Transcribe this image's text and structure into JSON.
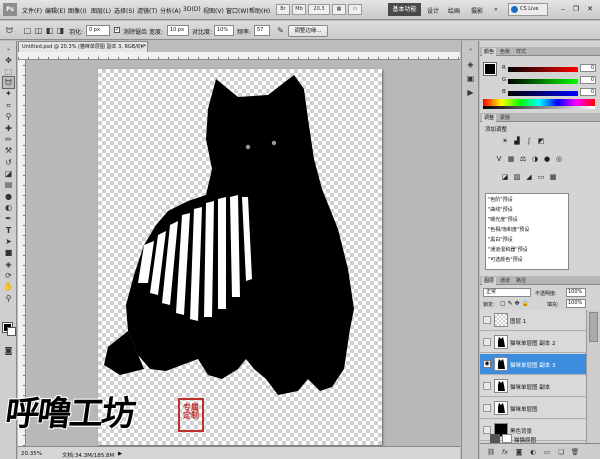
{
  "app": {
    "logo": "Ps",
    "menus": [
      "文件(F)",
      "编辑(E)",
      "图像(I)",
      "图层(L)",
      "选择(S)",
      "滤镜(T)",
      "分析(A)",
      "3D(D)",
      "视图(V)",
      "窗口(W)",
      "帮助(H)"
    ],
    "zoom_box": "20.3",
    "workspaces": {
      "active": "基本功能",
      "others": [
        "设计",
        "绘画",
        "摄影"
      ],
      "more": "»"
    },
    "cslive": "CS Live"
  },
  "options": {
    "feather_label": "羽化:",
    "feather_value": "0 px",
    "antialias_label": "消除锯齿",
    "width_label": "宽度:",
    "width_value": "10 px",
    "contrast_label": "对比度:",
    "contrast_value": "10%",
    "freq_label": "频率:",
    "freq_value": "57",
    "refine_button": "调整边缘..."
  },
  "document": {
    "tab": "Untitled.psd @ 20.3% (猫咪单层图 副本 3, RGB/8) *",
    "close": "×"
  },
  "status": {
    "zoom": "20.35%",
    "doc": "文档:34.3M/185.8M"
  },
  "watermark": {
    "text": "呼噜工坊",
    "seal": "专属定制"
  },
  "color_panel": {
    "tabs": [
      "颜色",
      "色板",
      "样式"
    ],
    "channels": [
      {
        "label": "R",
        "value": "0",
        "color": "#d92020"
      },
      {
        "label": "G",
        "value": "0",
        "color": "#1ea51e"
      },
      {
        "label": "B",
        "value": "0",
        "color": "#2040d9"
      }
    ]
  },
  "adjust_panel": {
    "tabs": [
      "调整",
      "蒙版"
    ],
    "title": "添加调整",
    "presets": [
      "\"色阶\"预设",
      "\"曲线\"预设",
      "\"曝光度\"预设",
      "\"色相/饱和度\"预设",
      "\"黑白\"预设",
      "\"通道混和器\"预设",
      "\"可选颜色\"预设"
    ]
  },
  "layers_panel": {
    "tabs": [
      "图层",
      "通道",
      "路径"
    ],
    "blend_mode": "正常",
    "opacity_label": "不透明度:",
    "opacity_value": "100%",
    "lock_label": "锁定:",
    "fill_label": "填充:",
    "fill_value": "100%",
    "layers": [
      {
        "name": "图层 1",
        "visible": false,
        "selected": false,
        "thumb": "transparent"
      },
      {
        "name": "猫咪单层图 副本 2",
        "visible": false,
        "selected": false,
        "thumb": "cat"
      },
      {
        "name": "猫咪单层图 副本 3",
        "visible": true,
        "selected": true,
        "thumb": "cat"
      },
      {
        "name": "猫咪单层图 副本",
        "visible": false,
        "selected": false,
        "thumb": "cat"
      },
      {
        "name": "猫咪单层图",
        "visible": false,
        "selected": false,
        "thumb": "cat"
      },
      {
        "name": "黑色背景",
        "visible": false,
        "selected": false,
        "thumb": "black"
      },
      {
        "name": "猫猫原图",
        "visible": false,
        "selected": false,
        "thumb": "photo"
      }
    ]
  },
  "colors": {
    "selection": "#3c8dde",
    "panel_bg": "#d4d4d4"
  }
}
